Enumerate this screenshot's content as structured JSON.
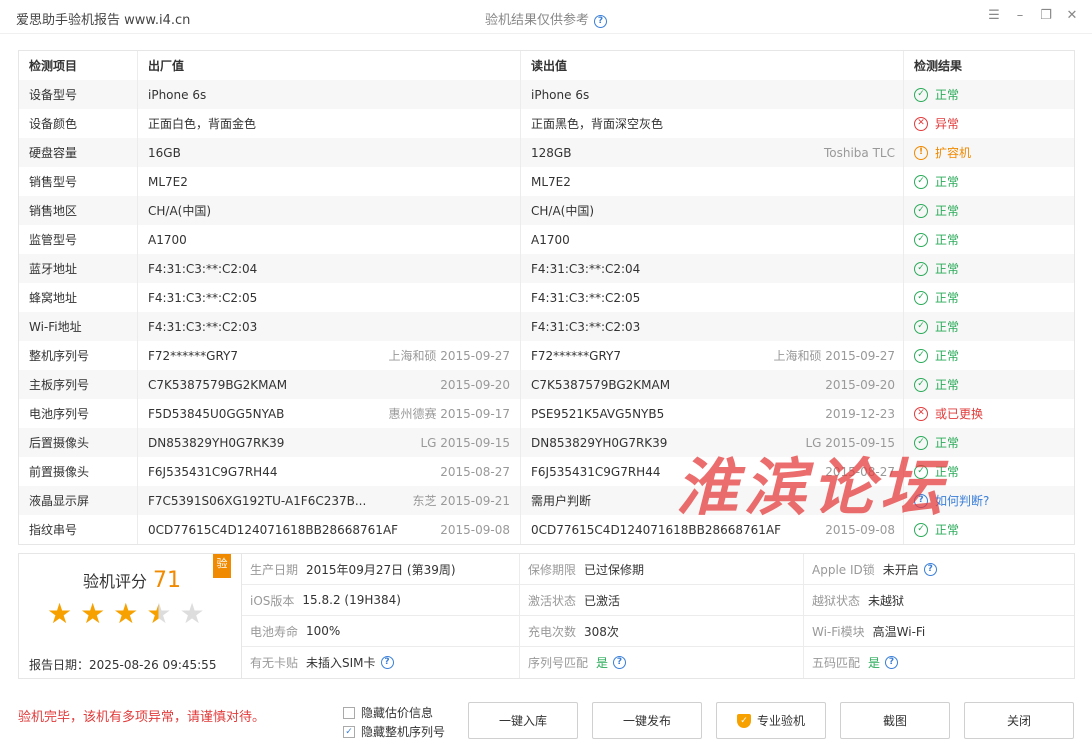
{
  "window": {
    "app_title": "爱思助手验机报告 www.i4.cn",
    "center_title": "验机结果仅供参考",
    "help_icon": "?"
  },
  "table": {
    "headers": [
      "检测项目",
      "出厂值",
      "读出值",
      "检测结果"
    ],
    "rows": [
      {
        "item": "设备型号",
        "factory": "iPhone 6s",
        "factory_note": "",
        "read": "iPhone 6s",
        "read_note": "",
        "status": "ok",
        "result": "正常"
      },
      {
        "item": "设备颜色",
        "factory": "正面白色，背面金色",
        "factory_note": "",
        "read": "正面黑色，背面深空灰色",
        "read_note": "",
        "status": "bad",
        "result": "异常"
      },
      {
        "item": "硬盘容量",
        "factory": "16GB",
        "factory_note": "",
        "read": "128GB",
        "read_note": "Toshiba TLC",
        "status": "warn",
        "result": "扩容机"
      },
      {
        "item": "销售型号",
        "factory": "ML7E2",
        "factory_note": "",
        "read": "ML7E2",
        "read_note": "",
        "status": "ok",
        "result": "正常"
      },
      {
        "item": "销售地区",
        "factory": "CH/A(中国)",
        "factory_note": "",
        "read": "CH/A(中国)",
        "read_note": "",
        "status": "ok",
        "result": "正常"
      },
      {
        "item": "监管型号",
        "factory": "A1700",
        "factory_note": "",
        "read": "A1700",
        "read_note": "",
        "status": "ok",
        "result": "正常"
      },
      {
        "item": "蓝牙地址",
        "factory": "F4:31:C3:**:C2:04",
        "factory_note": "",
        "read": "F4:31:C3:**:C2:04",
        "read_note": "",
        "status": "ok",
        "result": "正常"
      },
      {
        "item": "蜂窝地址",
        "factory": "F4:31:C3:**:C2:05",
        "factory_note": "",
        "read": "F4:31:C3:**:C2:05",
        "read_note": "",
        "status": "ok",
        "result": "正常"
      },
      {
        "item": "Wi-Fi地址",
        "factory": "F4:31:C3:**:C2:03",
        "factory_note": "",
        "read": "F4:31:C3:**:C2:03",
        "read_note": "",
        "status": "ok",
        "result": "正常"
      },
      {
        "item": "整机序列号",
        "factory": "F72******GRY7",
        "factory_note": "上海和硕 2015-09-27",
        "read": "F72******GRY7",
        "read_note": "上海和硕 2015-09-27",
        "status": "ok",
        "result": "正常"
      },
      {
        "item": "主板序列号",
        "factory": "C7K5387579BG2KMAM",
        "factory_note": "2015-09-20",
        "read": "C7K5387579BG2KMAM",
        "read_note": "2015-09-20",
        "status": "ok",
        "result": "正常"
      },
      {
        "item": "电池序列号",
        "factory": "F5D53845U0GG5NYAB",
        "factory_note": "惠州德赛 2015-09-17",
        "read": "PSE9521K5AVG5NYB5",
        "read_note": "2019-12-23",
        "status": "bad",
        "result": "或已更换"
      },
      {
        "item": "后置摄像头",
        "factory": "DN853829YH0G7RK39",
        "factory_note": "LG 2015-09-15",
        "read": "DN853829YH0G7RK39",
        "read_note": "LG 2015-09-15",
        "status": "ok",
        "result": "正常"
      },
      {
        "item": "前置摄像头",
        "factory": "F6J535431C9G7RH44",
        "factory_note": "2015-08-27",
        "read": "F6J535431C9G7RH44",
        "read_note": "2015-08-27",
        "status": "ok",
        "result": "正常"
      },
      {
        "item": "液晶显示屏",
        "factory": "F7C5391S06XG192TU-A1F6C237B...",
        "factory_note": "东芝 2015-09-21",
        "read": "需用户判断",
        "read_note": "",
        "status": "info",
        "result": "如何判断?"
      },
      {
        "item": "指纹串号",
        "factory": "0CD77615C4D124071618BB28668761AF",
        "factory_note": "2015-09-08",
        "read": "0CD77615C4D124071618BB28668761AF",
        "read_note": "2015-09-08",
        "status": "ok",
        "result": "正常"
      }
    ]
  },
  "watermark": "淮滨论坛",
  "score": {
    "label": "验机评分",
    "value": "71",
    "badge": "验",
    "stars": 3.5,
    "report_date": "报告日期：2025-08-26 09:45:55"
  },
  "info": [
    {
      "label": "生产日期",
      "value": "2015年09月27日 (第39周)",
      "help": false,
      "green": false
    },
    {
      "label": "保修期限",
      "value": "已过保修期",
      "help": false,
      "green": false
    },
    {
      "label": "Apple ID锁",
      "value": "未开启",
      "help": true,
      "green": false
    },
    {
      "label": "iOS版本",
      "value": "15.8.2 (19H384)",
      "help": false,
      "green": false
    },
    {
      "label": "激活状态",
      "value": "已激活",
      "help": false,
      "green": false
    },
    {
      "label": "越狱状态",
      "value": "未越狱",
      "help": false,
      "green": false
    },
    {
      "label": "电池寿命",
      "value": "100%",
      "help": false,
      "green": false
    },
    {
      "label": "充电次数",
      "value": "308次",
      "help": false,
      "green": false
    },
    {
      "label": "Wi-Fi模块",
      "value": "高温Wi-Fi",
      "help": false,
      "green": false
    },
    {
      "label": "有无卡贴",
      "value": "未插入SIM卡",
      "help": true,
      "green": false
    },
    {
      "label": "序列号匹配",
      "value": "是",
      "help": true,
      "green": true
    },
    {
      "label": "五码匹配",
      "value": "是",
      "help": true,
      "green": true
    }
  ],
  "footer": {
    "warning": "验机完毕，该机有多项异常，请谨慎对待。",
    "check1": {
      "label": "隐藏估价信息",
      "checked": false
    },
    "check2": {
      "label": "隐藏整机序列号",
      "checked": true
    },
    "buttons": {
      "import": "一键入库",
      "publish": "一键发布",
      "pro": "专业验机",
      "screenshot": "截图",
      "close": "关闭"
    }
  },
  "colors": {
    "ok": "#2bab5a",
    "bad": "#e23b3b",
    "warn": "#f08a00",
    "info": "#3a7fd9",
    "star": "#f6a100"
  }
}
